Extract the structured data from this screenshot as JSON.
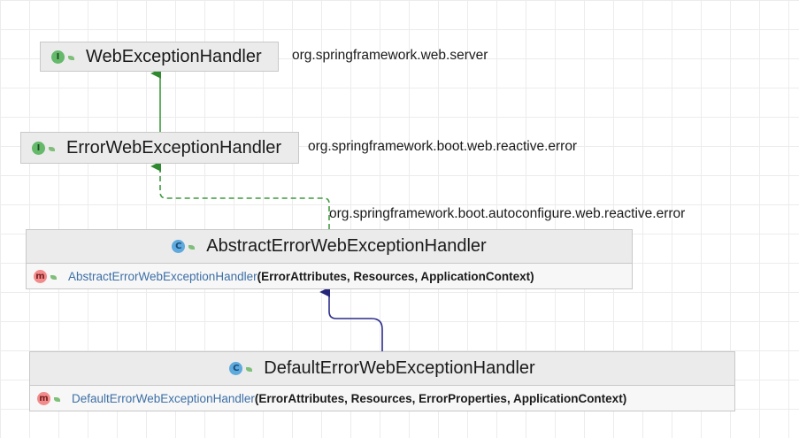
{
  "diagram": {
    "nodes": [
      {
        "id": "web_exception_handler",
        "kind": "interface",
        "badge": "I",
        "name": "WebExceptionHandler",
        "package": "org.springframework.web.server"
      },
      {
        "id": "error_web_exception_handler",
        "kind": "interface",
        "badge": "I",
        "name": "ErrorWebExceptionHandler",
        "package": "org.springframework.boot.web.reactive.error"
      },
      {
        "id": "abstract_error_web_exception_handler",
        "kind": "class",
        "badge": "C",
        "name": "AbstractErrorWebExceptionHandler",
        "package": "org.springframework.boot.autoconfigure.web.reactive.error",
        "members": [
          {
            "badge": "m",
            "name": "AbstractErrorWebExceptionHandler",
            "params": "(ErrorAttributes, Resources, ApplicationContext)"
          }
        ]
      },
      {
        "id": "default_error_web_exception_handler",
        "kind": "class",
        "badge": "C",
        "name": "DefaultErrorWebExceptionHandler",
        "members": [
          {
            "badge": "m",
            "name": "DefaultErrorWebExceptionHandler",
            "params": "(ErrorAttributes, Resources, ErrorProperties, ApplicationContext)"
          }
        ]
      }
    ],
    "edges": [
      {
        "from": "error_web_exception_handler",
        "to": "web_exception_handler",
        "type": "extends",
        "color": "#3f9a3f"
      },
      {
        "from": "abstract_error_web_exception_handler",
        "to": "error_web_exception_handler",
        "type": "implements",
        "color": "#3f9a3f"
      },
      {
        "from": "default_error_web_exception_handler",
        "to": "abstract_error_web_exception_handler",
        "type": "extends",
        "color": "#2c2c8c"
      }
    ]
  }
}
